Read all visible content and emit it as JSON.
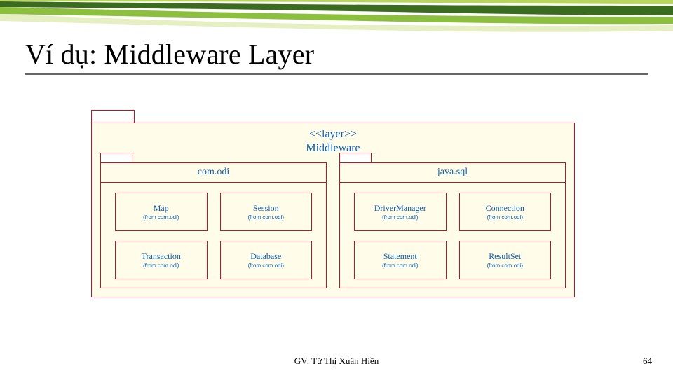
{
  "title": "Ví dụ: Middleware Layer",
  "diagram": {
    "layer_stereotype": "<<layer>>",
    "layer_name": "Middleware",
    "packages": [
      {
        "name": "com.odi",
        "classes": [
          {
            "name": "Map",
            "from": "(from com.odi)"
          },
          {
            "name": "Session",
            "from": "(from com.odi)"
          },
          {
            "name": "Transaction",
            "from": "(from com.odi)"
          },
          {
            "name": "Database",
            "from": "(from com.odi)"
          }
        ]
      },
      {
        "name": "java.sql",
        "classes": [
          {
            "name": "DriverManager",
            "from": "(from com.odi)"
          },
          {
            "name": "Connection",
            "from": "(from com.odi)"
          },
          {
            "name": "Statement",
            "from": "(from com.odi)"
          },
          {
            "name": "ResultSet",
            "from": "(from com.odi)"
          }
        ]
      }
    ]
  },
  "footer": {
    "author": "GV: Từ Thị Xuân Hiền",
    "page": "64"
  }
}
